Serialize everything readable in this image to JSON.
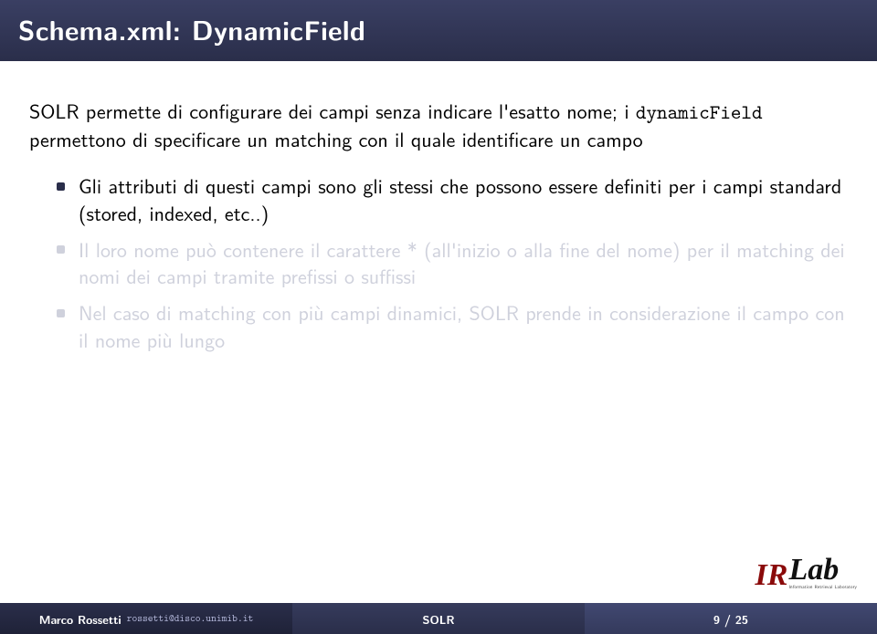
{
  "title": "Schema.xml: DynamicField",
  "intro_parts": {
    "p1": "SOLR permette di configurare dei campi senza indicare l'esatto nome; i ",
    "tt": "dynamicField",
    "p2": " permettono di specificare un matching con il quale identificare un campo"
  },
  "bullets": [
    {
      "text": "Gli attributi di questi campi sono gli stessi che possono essere definiti per i campi standard (stored, indexed, etc..)",
      "dim": false
    },
    {
      "text": "Il loro nome può contenere il carattere * (all'inizio o alla fine del nome) per il matching dei nomi dei campi tramite prefissi o suffissi",
      "dim": true
    },
    {
      "text": "Nel caso di matching con più campi dinamici, SOLR prende in considerazione il campo con il nome più lungo",
      "dim": true
    }
  ],
  "logo": {
    "ir": "IR",
    "lab": "Lab",
    "sub": "Information Retrieval Laboratory"
  },
  "footer": {
    "author": "Marco Rossetti",
    "email": "rossetti@disco.unimib.it",
    "short_title": "SOLR",
    "page": "9 / 25"
  }
}
